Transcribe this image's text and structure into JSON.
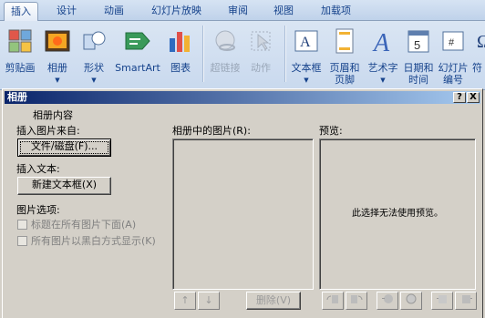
{
  "ribbon": {
    "tabs": [
      "插入",
      "设计",
      "动画",
      "幻灯片放映",
      "审阅",
      "视图",
      "加载项"
    ],
    "buttons": {
      "clip_art": "剪贴画",
      "album": "相册",
      "shapes": "形状",
      "smartart": "SmartArt",
      "chart": "图表",
      "hyperlink": "超链接",
      "action": "动作",
      "textbox": "文本框",
      "header_footer": "页眉和\n页脚",
      "wordart": "艺术字",
      "datetime": "日期和\n时间",
      "slide_number": "幻灯片\n编号",
      "symbol_partial": "符"
    }
  },
  "dialog": {
    "title": "相册",
    "help": "?",
    "close": "X",
    "section_heading": "相册内容",
    "insert_picture_from": "插入图片来自:",
    "file_disk_button": "文件/磁盘(F)...",
    "insert_text": "插入文本:",
    "new_textbox_button": "新建文本框(X)",
    "picture_options": "图片选项:",
    "option_captions": "标题在所有图片下面(A)",
    "option_bw": "所有图片以黑白方式显示(K)",
    "pictures_in_album": "相册中的图片(R):",
    "preview_label": "预览:",
    "preview_message": "此选择无法使用预览。",
    "move_up": "↑",
    "move_down": "↓",
    "remove_button": "删除(V)"
  }
}
